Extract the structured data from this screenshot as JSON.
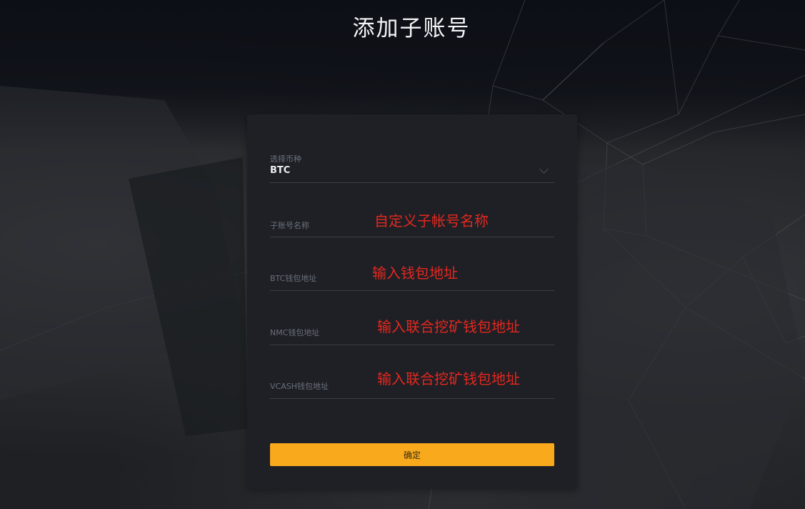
{
  "page": {
    "title": "添加子账号"
  },
  "form": {
    "coin_select": {
      "label": "选择币种",
      "value": "BTC",
      "icon": "chevron-down-icon"
    },
    "fields": [
      {
        "key": "subaccount_name",
        "label": "子账号名称",
        "value": ""
      },
      {
        "key": "btc_address",
        "label": "BTC钱包地址",
        "value": ""
      },
      {
        "key": "nmc_address",
        "label": "NMC钱包地址",
        "value": ""
      },
      {
        "key": "vcash_address",
        "label": "VCASH钱包地址",
        "value": ""
      }
    ],
    "confirm_label": "确定"
  },
  "annotations": {
    "subaccount_name": "自定义子帐号名称",
    "btc_address": "输入钱包地址",
    "nmc_address": "输入联合挖矿钱包地址",
    "vcash_address": "输入联合挖矿钱包地址"
  },
  "colors": {
    "accent": "#f8a91c",
    "card": "#1e2026",
    "annotation": "#e4271e",
    "title": "#f3f4f6"
  }
}
